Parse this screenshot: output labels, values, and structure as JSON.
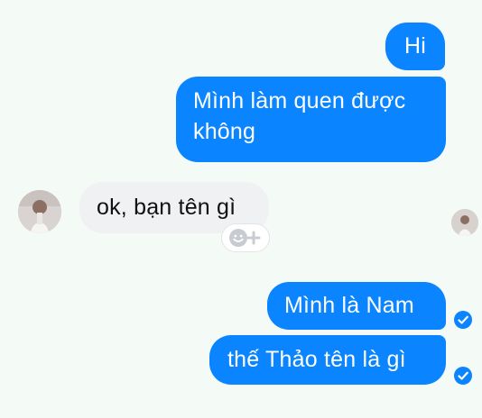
{
  "messages": [
    {
      "direction": "outgoing",
      "text": "Hi"
    },
    {
      "direction": "outgoing",
      "text": "Mình làm quen được không"
    },
    {
      "direction": "incoming",
      "text": "ok, bạn tên gì"
    },
    {
      "direction": "outgoing",
      "text": "Mình là Nam"
    },
    {
      "direction": "outgoing",
      "text": "thế Thảo tên là gì"
    }
  ],
  "icons": {
    "contact_avatar": "avatar",
    "seen_indicator": "avatar",
    "reaction": "smiley-plus-icon",
    "delivered": "check-circle-icon"
  },
  "colors": {
    "background": "#f4fbf6",
    "outgoing_bubble": "#0a84ff",
    "incoming_bubble": "#f0f1f3",
    "outgoing_text": "#ffffff",
    "incoming_text": "#111111"
  }
}
